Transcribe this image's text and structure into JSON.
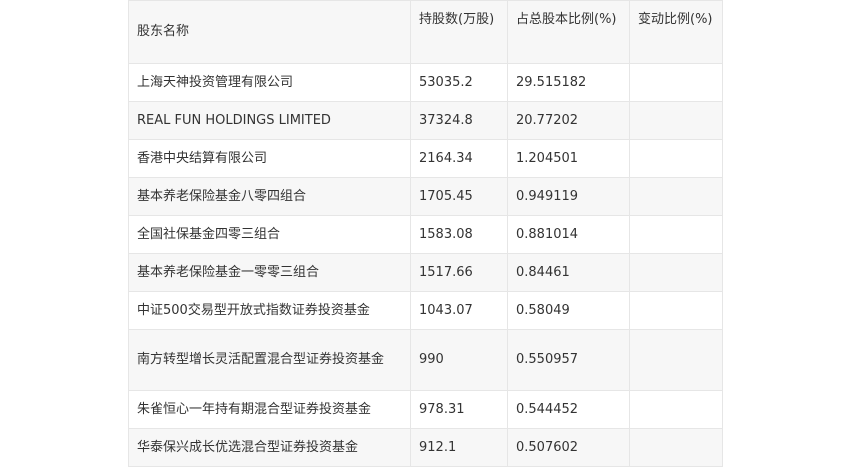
{
  "table": {
    "headers": {
      "name": "股东名称",
      "shares": "持股数(万股)",
      "ratio": "占总股本比例(%)",
      "change": "变动比例(%)"
    },
    "rows": [
      {
        "name": "上海天神投资管理有限公司",
        "shares": "53035.2",
        "ratio": "29.515182",
        "change": ""
      },
      {
        "name": "REAL FUN HOLDINGS LIMITED",
        "shares": "37324.8",
        "ratio": "20.77202",
        "change": ""
      },
      {
        "name": "香港中央结算有限公司",
        "shares": "2164.34",
        "ratio": "1.204501",
        "change": ""
      },
      {
        "name": "基本养老保险基金八零四组合",
        "shares": "1705.45",
        "ratio": "0.949119",
        "change": ""
      },
      {
        "name": "全国社保基金四零三组合",
        "shares": "1583.08",
        "ratio": "0.881014",
        "change": ""
      },
      {
        "name": "基本养老保险基金一零零三组合",
        "shares": "1517.66",
        "ratio": "0.84461",
        "change": ""
      },
      {
        "name": "中证500交易型开放式指数证券投资基金",
        "shares": "1043.07",
        "ratio": "0.58049",
        "change": ""
      },
      {
        "name": "南方转型增长灵活配置混合型证券投资基金",
        "shares": "990",
        "ratio": "0.550957",
        "change": ""
      },
      {
        "name": "朱雀恒心一年持有期混合型证券投资基金",
        "shares": "978.31",
        "ratio": "0.544452",
        "change": ""
      },
      {
        "name": "华泰保兴成长优选混合型证券投资基金",
        "shares": "912.1",
        "ratio": "0.507602",
        "change": ""
      }
    ]
  }
}
